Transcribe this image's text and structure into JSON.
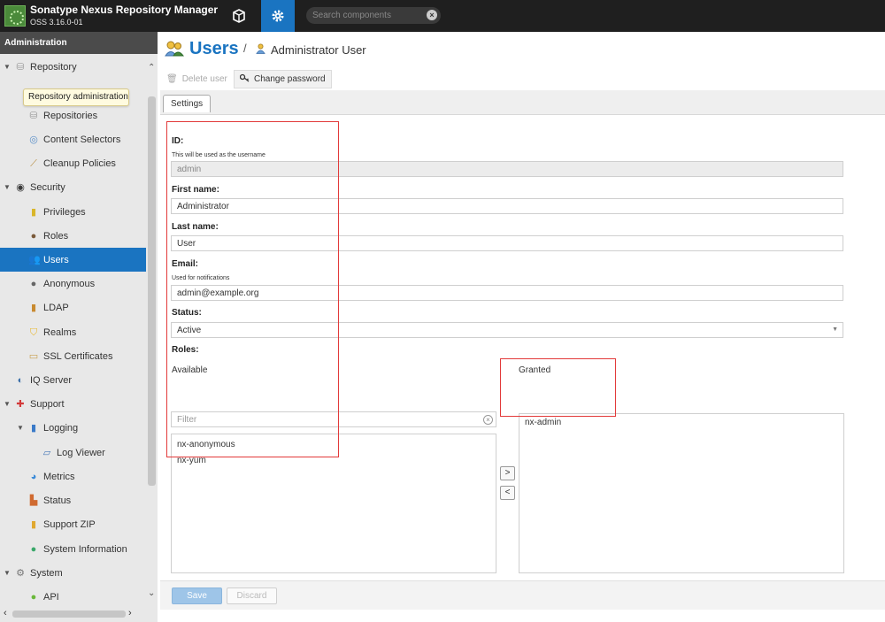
{
  "header": {
    "app_title": "Sonatype Nexus Repository Manager",
    "app_version": "OSS 3.16.0-01",
    "search_placeholder": "Search components"
  },
  "sidebar": {
    "heading": "Administration",
    "tooltip": "Repository administration",
    "items": [
      {
        "label": "Repository",
        "icon": "database-icon"
      },
      {
        "label": "Repositories",
        "icon": "database-icon"
      },
      {
        "label": "Content Selectors",
        "icon": "content-selector-icon"
      },
      {
        "label": "Cleanup Policies",
        "icon": "broom-icon"
      },
      {
        "label": "Security",
        "icon": "badge-icon"
      },
      {
        "label": "Privileges",
        "icon": "medal-icon"
      },
      {
        "label": "Roles",
        "icon": "role-user-icon"
      },
      {
        "label": "Users",
        "icon": "users-icon"
      },
      {
        "label": "Anonymous",
        "icon": "anonymous-user-icon"
      },
      {
        "label": "LDAP",
        "icon": "ldap-book-icon"
      },
      {
        "label": "Realms",
        "icon": "shield-icon"
      },
      {
        "label": "SSL Certificates",
        "icon": "certificate-icon"
      },
      {
        "label": "IQ Server",
        "icon": "iq-server-icon"
      },
      {
        "label": "Support",
        "icon": "support-icon"
      },
      {
        "label": "Logging",
        "icon": "book-icon"
      },
      {
        "label": "Log Viewer",
        "icon": "scroll-icon"
      },
      {
        "label": "Metrics",
        "icon": "pie-chart-icon"
      },
      {
        "label": "Status",
        "icon": "bar-chart-icon"
      },
      {
        "label": "Support ZIP",
        "icon": "zip-icon"
      },
      {
        "label": "System Information",
        "icon": "globe-icon"
      },
      {
        "label": "System",
        "icon": "gear-icon"
      },
      {
        "label": "API",
        "icon": "api-icon"
      }
    ],
    "selected": "Users"
  },
  "page": {
    "title": "Users",
    "separator": "/",
    "subtitle": "Administrator User",
    "toolbar": {
      "delete_label": "Delete user",
      "change_password_label": "Change password"
    },
    "tab": "Settings"
  },
  "form": {
    "id_label": "ID:",
    "id_help": "This will be used as the username",
    "id_value": "admin",
    "first_name_label": "First name:",
    "first_name_value": "Administrator",
    "last_name_label": "Last name:",
    "last_name_value": "User",
    "email_label": "Email:",
    "email_help": "Used for notifications",
    "email_value": "admin@example.org",
    "status_label": "Status:",
    "status_value": "Active",
    "roles_label": "Roles:",
    "available_label": "Available",
    "granted_label": "Granted",
    "filter_placeholder": "Filter",
    "available_roles": [
      "nx-anonymous",
      "nx-yum"
    ],
    "granted_roles": [
      "nx-admin"
    ],
    "move_right": ">",
    "move_left": "<"
  },
  "footer": {
    "save_label": "Save",
    "discard_label": "Discard"
  },
  "colors": {
    "header_bg": "#1f1f1f",
    "accent": "#1a74c1",
    "sidebar_bg": "#e8e8e8",
    "annotation_red": "#e23a3a"
  }
}
